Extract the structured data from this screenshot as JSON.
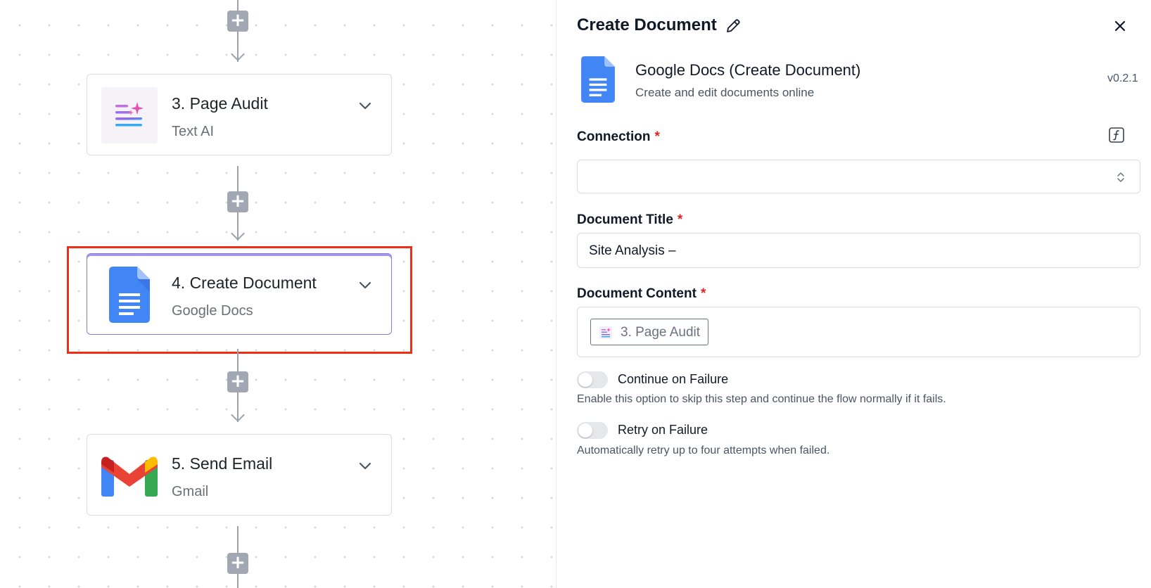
{
  "canvas": {
    "steps": [
      {
        "number": "3",
        "title": "3. Page Audit",
        "subtitle": "Text AI",
        "icon": "text-ai-icon"
      },
      {
        "number": "4",
        "title": "4. Create Document",
        "subtitle": "Google Docs",
        "icon": "google-docs-icon",
        "selected": true
      },
      {
        "number": "5",
        "title": "5. Send Email",
        "subtitle": "Gmail",
        "icon": "gmail-icon"
      }
    ],
    "add_glyph": "+"
  },
  "panel": {
    "title": "Create Document",
    "app_name": "Google Docs (Create Document)",
    "app_description": "Create and edit documents online",
    "version": "v0.2.1",
    "connection": {
      "label": "Connection",
      "required_mark": "*",
      "value": ""
    },
    "document_title": {
      "label": "Document Title",
      "required_mark": "*",
      "value": "Site Analysis –"
    },
    "document_content": {
      "label": "Document Content",
      "required_mark": "*",
      "chip_label": "3. Page Audit"
    },
    "continue_on_failure": {
      "label": "Continue on Failure",
      "description": "Enable this option to skip this step and continue the flow normally if it fails.",
      "enabled": false
    },
    "retry_on_failure": {
      "label": "Retry on Failure",
      "description": "Automatically retry up to four attempts when failed.",
      "enabled": false
    }
  },
  "colors": {
    "highlight": "#f02d16",
    "selected_border": "#8b7ad6",
    "required": "#e02424",
    "google_docs_blue": "#4285f4"
  }
}
